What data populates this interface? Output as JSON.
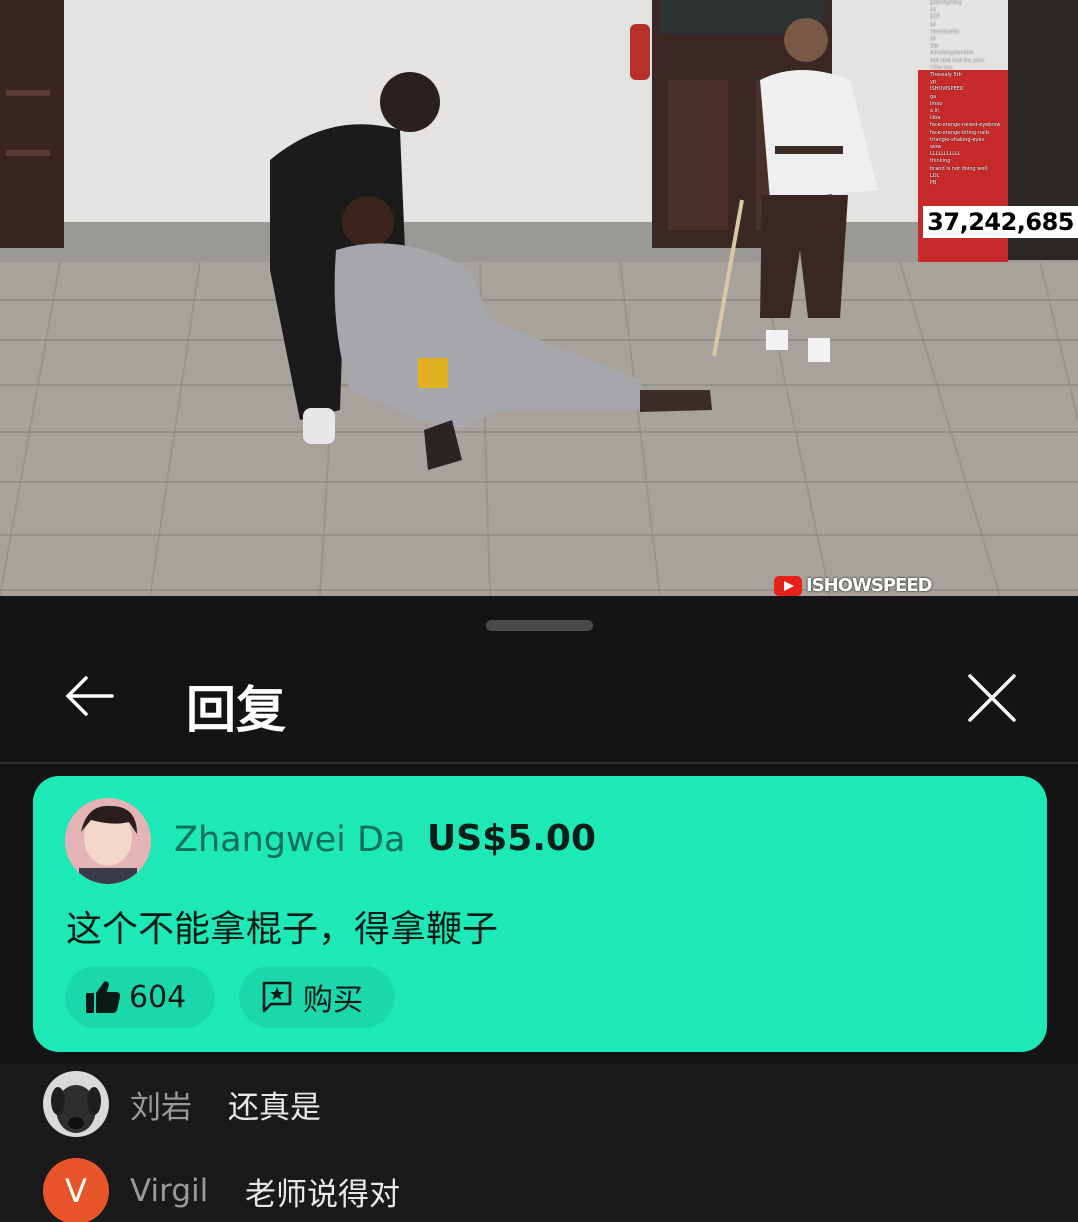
{
  "video": {
    "viewer_count": "37,242,685",
    "watermark": "ISHOWSPEED",
    "chat_lines": [
      "ghimfighting",
      "ok",
      "ECP",
      "lol",
      "nlandbuddy",
      "ok",
      "slip",
      "slimskingdomkim",
      "hell look fuel the pain",
      "f the rise",
      "Thessaly 5th",
      "yp",
      "ISHOWSPEED",
      "ga",
      "lmao",
      "a lil",
      "iliba",
      "face-orange-raised-eyebrow",
      "face-orange-biting-nails",
      "triangle-shaking-eyes",
      "wow",
      "LLLLLLLLLLL",
      "thinking",
      "brand is not doing well",
      "LOL",
      "PB"
    ]
  },
  "sheet": {
    "title": "回复",
    "back_icon": "arrow-left-icon",
    "close_icon": "close-icon"
  },
  "superchat": {
    "author": "Zhangwei Da",
    "amount": "US$5.00",
    "message": "这个不能拿棍子，得拿鞭子",
    "likes": "604",
    "buy_label": "购买",
    "card_color": "#1de9b6"
  },
  "replies": [
    {
      "author": "刘岩",
      "text": "还真是",
      "avatar": "dog-avatar"
    },
    {
      "author": "Virgil",
      "text": "老师说得对",
      "avatar_letter": "V",
      "avatar_color": "#e8552a"
    }
  ]
}
